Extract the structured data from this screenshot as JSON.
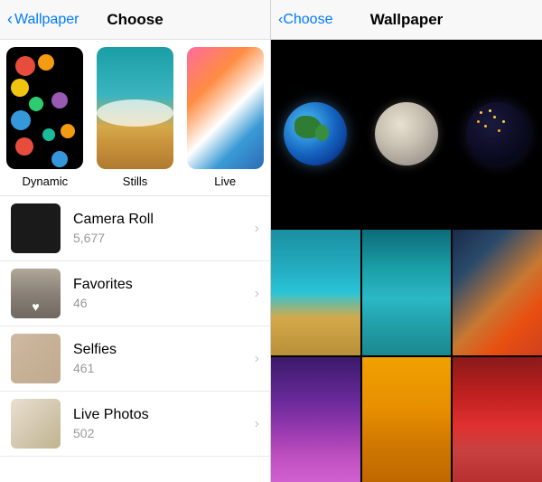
{
  "left": {
    "nav": {
      "back_label": "Wallpaper",
      "title": "Choose"
    },
    "categories": [
      {
        "id": "dynamic",
        "label": "Dynamic"
      },
      {
        "id": "stills",
        "label": "Stills"
      },
      {
        "id": "live",
        "label": "Live"
      }
    ],
    "list_items": [
      {
        "id": "camera-roll",
        "name": "Camera Roll",
        "count": "5,677"
      },
      {
        "id": "favorites",
        "name": "Favorites",
        "count": "46"
      },
      {
        "id": "selfies",
        "name": "Selfies",
        "count": "461"
      },
      {
        "id": "live-photos",
        "name": "Live Photos",
        "count": "502"
      }
    ]
  },
  "right": {
    "nav": {
      "back_label": "Choose",
      "title": "Wallpaper"
    }
  }
}
